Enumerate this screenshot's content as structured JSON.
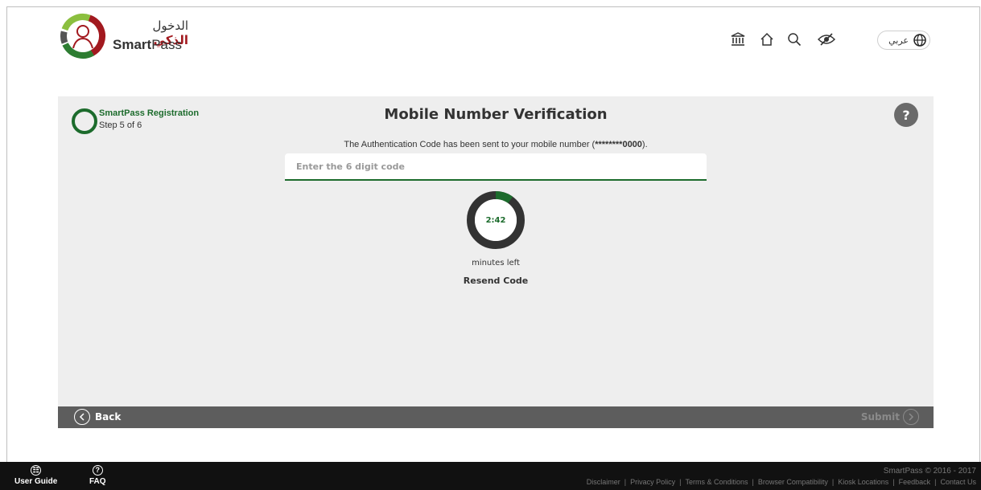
{
  "header": {
    "logo_arabic_prefix": "الدخول",
    "logo_arabic_bold": "الذكي",
    "logo_english_bold": "Smart",
    "logo_english_rest": "Pass",
    "language_label": "عربي",
    "icons": [
      "institution-icon",
      "home-icon",
      "search-icon",
      "accessibility-eye-icon",
      "globe-icon"
    ]
  },
  "step": {
    "title": "SmartPass Registration",
    "subtitle": "Step 5 of 6"
  },
  "page_title": "Mobile Number Verification",
  "help_label": "?",
  "message": {
    "prefix": "The Authentication Code has been sent to your mobile number (",
    "masked_number": "********0000",
    "suffix": ")."
  },
  "code_input": {
    "placeholder": "Enter the 6 digit code",
    "value": ""
  },
  "timer": {
    "display": "2:42",
    "label": "minutes left",
    "elapsed_fraction": 0.1,
    "track_color": "#333333",
    "progress_color": "#1c6b2c"
  },
  "resend_label": "Resend Code",
  "actions": {
    "back_label": "Back",
    "submit_label": "Submit"
  },
  "footer": {
    "user_guide_label": "User Guide",
    "faq_label": "FAQ",
    "copyright": "SmartPass © 2016 - 2017",
    "links": [
      "Disclaimer",
      "Privacy Policy",
      "Terms & Conditions",
      "Browser Compatibility",
      "Kiosk Locations",
      "Feedback",
      "Contact Us"
    ]
  },
  "colors": {
    "accent_green": "#1c6b2c",
    "logo_red": "#a2191f",
    "card_bg": "#eeeeee",
    "action_bar_bg": "#5d5d5d",
    "footer_bg": "#111111"
  }
}
